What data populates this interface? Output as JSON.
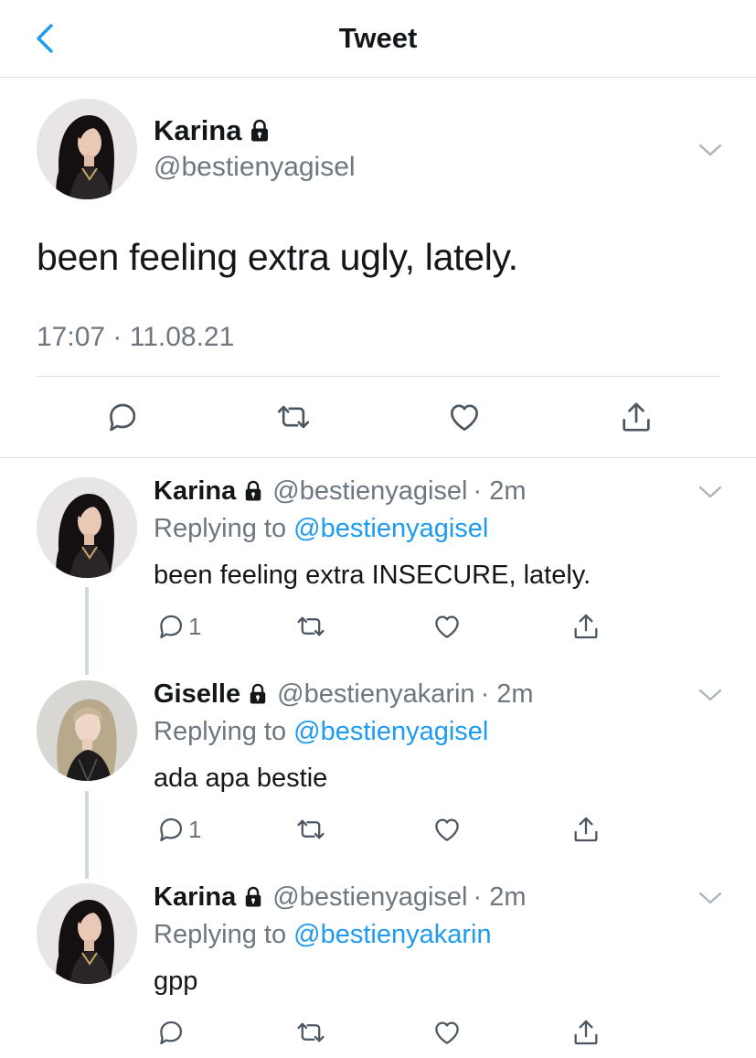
{
  "nav": {
    "title": "Tweet",
    "back_icon": "chevron-left-icon",
    "accent": "#1d9bf0"
  },
  "main_tweet": {
    "author_name": "Karina",
    "handle": "@bestienyagisel",
    "text": "been feeling extra ugly, lately.",
    "timestamp": "17:07 · 11.08.21",
    "locked": true
  },
  "replies": [
    {
      "author_name": "Karina",
      "handle": "@bestienyagisel",
      "time": "· 2m",
      "replying_prefix": "Replying to ",
      "replying_to": "@bestienyagisel",
      "text": "been feeling extra INSECURE, lately.",
      "reply_count": "1",
      "locked": true
    },
    {
      "author_name": "Giselle",
      "handle": "@bestienyakarin",
      "time": "· 2m",
      "replying_prefix": "Replying to ",
      "replying_to": "@bestienyagisel",
      "text": "ada apa bestie",
      "reply_count": "1",
      "locked": true
    },
    {
      "author_name": "Karina",
      "handle": "@bestienyagisel",
      "time": "· 2m",
      "replying_prefix": "Replying to ",
      "replying_to": "@bestienyakarin",
      "text": "gpp",
      "reply_count": "",
      "locked": true
    }
  ],
  "icons": [
    "chevron-left-icon",
    "lock-icon",
    "chevron-down-icon",
    "reply-icon",
    "retweet-icon",
    "like-icon",
    "share-icon"
  ],
  "colors": {
    "text": "#14171a",
    "secondary": "#6e7780",
    "link": "#1d9bf0",
    "divider": "#dcdfe2",
    "thread_line": "#cfd9de"
  }
}
